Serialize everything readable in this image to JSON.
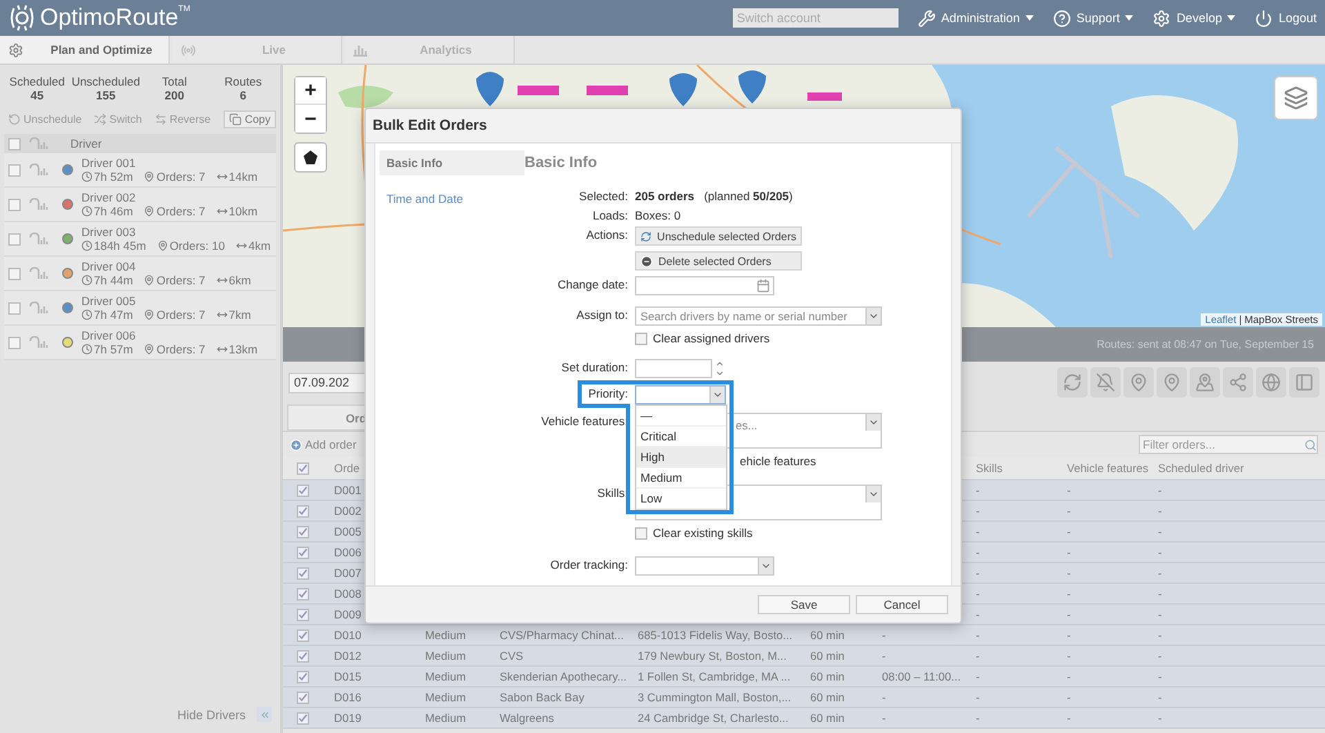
{
  "header": {
    "logo": "OptimoRoute",
    "trademark": "TM",
    "switch_account": {
      "placeholder": "Switch account"
    },
    "menus": [
      {
        "kind": "tools",
        "label": "Administration",
        "dropdown": true
      },
      {
        "kind": "help",
        "label": "Support",
        "dropdown": true
      },
      {
        "kind": "gear",
        "label": "Develop",
        "dropdown": true
      },
      {
        "kind": "power",
        "label": "Logout",
        "dropdown": false
      }
    ]
  },
  "tabs": [
    {
      "kind": "gear",
      "label": "Plan and Optimize",
      "selected": true
    },
    {
      "kind": "live",
      "label": "Live",
      "selected": false
    },
    {
      "kind": "chart",
      "label": "Analytics",
      "selected": false
    }
  ],
  "summary": [
    {
      "label": "Scheduled",
      "value": "45"
    },
    {
      "label": "Unscheduled",
      "value": "155"
    },
    {
      "label": "Total",
      "value": "200"
    },
    {
      "label": "Routes",
      "value": "6"
    }
  ],
  "driver_actions": [
    {
      "kind": "unschedule",
      "label": "Unschedule",
      "disabled": true
    },
    {
      "kind": "switch",
      "label": "Switch",
      "disabled": true
    },
    {
      "kind": "reverse",
      "label": "Reverse",
      "disabled": true
    },
    {
      "kind": "copy",
      "label": "Copy",
      "disabled": false
    }
  ],
  "drivers_header": {
    "label": "Driver",
    "checked": false
  },
  "drivers": [
    {
      "name": "Driver 001",
      "checked": false,
      "color": "#5b8fc7",
      "time": "7h 52m",
      "orders": "Orders: 7",
      "distance": "14km"
    },
    {
      "name": "Driver 002",
      "checked": false,
      "color": "#d9726a",
      "time": "7h 46m",
      "orders": "Orders: 7",
      "distance": "10km"
    },
    {
      "name": "Driver 003",
      "checked": false,
      "color": "#7fb069",
      "time": "184h 45m",
      "orders": "Orders: 10",
      "distance": "4km"
    },
    {
      "name": "Driver 004",
      "checked": false,
      "color": "#e0a36b",
      "time": "7h 44m",
      "orders": "Orders: 7",
      "distance": "6km"
    },
    {
      "name": "Driver 005",
      "checked": false,
      "color": "#5b8fc7",
      "time": "7h 47m",
      "orders": "Orders: 7",
      "distance": "7km"
    },
    {
      "name": "Driver 006",
      "checked": false,
      "color": "#e3dc7a",
      "time": "7h 57m",
      "orders": "Orders: 7",
      "distance": "13km"
    }
  ],
  "hide_drivers": "Hide Drivers",
  "map": {
    "zoom_in": "+",
    "zoom_out": "−",
    "attribution_link": "Leaflet",
    "separator": "|",
    "attribution": "MapBox Streets"
  },
  "status_bar": "Routes: sent at 08:47 on Tue, September 15",
  "toolbar": {
    "date": "07.09.202",
    "tools": [
      {
        "kind": "refresh"
      },
      {
        "kind": "bell-off"
      },
      {
        "kind": "pin"
      },
      {
        "kind": "pin"
      },
      {
        "kind": "pins"
      },
      {
        "kind": "share"
      },
      {
        "kind": "globe"
      },
      {
        "kind": "panel"
      }
    ]
  },
  "subtab": "Ord",
  "add_order": "Add order",
  "filter": {
    "placeholder": "Filter orders..."
  },
  "table": {
    "all_checked": true,
    "columns": {
      "order": "Orde",
      "skills": "Skills",
      "vehicle_features": "Vehicle features",
      "scheduled_driver": "Scheduled driver"
    },
    "rows": [
      {
        "checked": true,
        "order": "D001",
        "skills": "-",
        "vehicle_features": "-",
        "scheduled_driver": "-"
      },
      {
        "checked": true,
        "order": "D002",
        "skills": "-",
        "vehicle_features": "-",
        "scheduled_driver": "-"
      },
      {
        "checked": true,
        "order": "D005",
        "skills": "-",
        "vehicle_features": "-",
        "scheduled_driver": "-"
      },
      {
        "checked": true,
        "order": "D006",
        "skills": "-",
        "vehicle_features": "-",
        "scheduled_driver": "-"
      },
      {
        "checked": true,
        "order": "D007",
        "skills": "-",
        "vehicle_features": "-",
        "scheduled_driver": "-"
      },
      {
        "checked": true,
        "order": "D008",
        "skills": "-",
        "vehicle_features": "-",
        "scheduled_driver": "-"
      },
      {
        "checked": true,
        "order": "D009",
        "skills": "-",
        "vehicle_features": "-",
        "scheduled_driver": "-"
      },
      {
        "checked": true,
        "order": "D010",
        "priority": "Medium",
        "location": "CVS/Pharmacy Chinat...",
        "address": "685-1013 Fidelis Way, Bosto...",
        "duration": "60 min",
        "time_window": "-",
        "skills": "-",
        "vehicle_features": "-",
        "scheduled_driver": "-"
      },
      {
        "checked": true,
        "order": "D012",
        "priority": "Medium",
        "location": "CVS",
        "address": "179 Newbury St, Boston, M...",
        "duration": "60 min",
        "time_window": "-",
        "skills": "-",
        "vehicle_features": "-",
        "scheduled_driver": "-"
      },
      {
        "checked": true,
        "order": "D015",
        "priority": "Medium",
        "location": "Skenderian Apothecary...",
        "address": "1 Follen St, Cambridge, MA ...",
        "duration": "60 min",
        "time_window": "08:00 – 11:00...",
        "skills": "-",
        "vehicle_features": "-",
        "scheduled_driver": "-"
      },
      {
        "checked": true,
        "order": "D016",
        "priority": "Medium",
        "location": "Sabon Back Bay",
        "address": "3 Cummington Mall, Boston,...",
        "duration": "60 min",
        "time_window": "-",
        "skills": "-",
        "vehicle_features": "-",
        "scheduled_driver": "-"
      },
      {
        "checked": true,
        "order": "D019",
        "priority": "Medium",
        "location": "Walgreens",
        "address": "24 Cambridge St, Charlesto...",
        "duration": "60 min",
        "time_window": "-",
        "skills": "-",
        "vehicle_features": "-",
        "scheduled_driver": "-"
      }
    ]
  },
  "modal": {
    "title": "Bulk Edit Orders",
    "nav": [
      {
        "label": "Basic Info",
        "selected": true
      },
      {
        "label": "Time and Date",
        "selected": false
      }
    ],
    "heading": "Basic Info",
    "fields": [
      {
        "kind": "text",
        "label": "Selected:",
        "value": "**205 orders**   (planned **50/205**)"
      },
      {
        "kind": "text",
        "label": "Loads:",
        "value": "Boxes: 0"
      },
      {
        "kind": "actions",
        "label": "Actions:",
        "buttons": [
          {
            "kind": "unschedule",
            "label": "Unschedule selected Orders"
          },
          {
            "kind": "delete",
            "label": "Delete selected Orders"
          }
        ]
      },
      {
        "kind": "date",
        "label": "Change date:"
      },
      {
        "kind": "select",
        "label": "Assign to:",
        "placeholder": "Search drivers by name or serial number",
        "checkbox": {
          "label": "Clear assigned drivers",
          "checked": false
        }
      },
      {
        "kind": "spinner",
        "label": "Set duration:"
      },
      {
        "kind": "priority",
        "label": "Priority:",
        "expanded": true,
        "highlight": true,
        "options": [
          {
            "label": "—",
            "selected": false
          },
          {
            "label": "Critical",
            "selected": false
          },
          {
            "label": "High",
            "selected": true
          },
          {
            "label": "Medium",
            "selected": false
          },
          {
            "label": "Low",
            "selected": false
          }
        ]
      },
      {
        "kind": "multiselect",
        "label": "Vehicle features:",
        "placeholder": "es...",
        "covered_text": "ehicle features"
      },
      {
        "kind": "multiselect",
        "label": "Skills:",
        "checkbox": {
          "label": "Clear existing skills",
          "checked": false
        }
      },
      {
        "kind": "select",
        "label": "Order tracking:"
      }
    ],
    "buttons": [
      "Save",
      "Cancel"
    ]
  }
}
